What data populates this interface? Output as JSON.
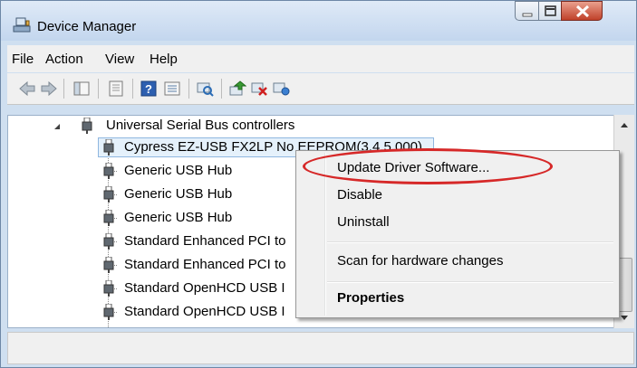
{
  "window": {
    "title": "Device Manager"
  },
  "menu": [
    "File",
    "Action",
    "View",
    "Help"
  ],
  "toolbar": {
    "buttons": [
      "back-icon",
      "forward-icon",
      "show-hide-tree-icon",
      "properties-icon",
      "help-icon",
      "view-icon",
      "scan-hardware-icon",
      "update-driver-icon",
      "uninstall-icon",
      "enable-icon"
    ]
  },
  "tree": {
    "category": "Universal Serial Bus controllers",
    "items": [
      "Cypress EZ-USB FX2LP No EEPROM(3.4.5.000)",
      "Generic USB Hub",
      "Generic USB Hub",
      "Generic USB Hub",
      "Standard Enhanced PCI to",
      "Standard Enhanced PCI to",
      "Standard OpenHCD USB I",
      "Standard OpenHCD USB I"
    ]
  },
  "context_menu": {
    "update_driver": "Update Driver Software...",
    "disable": "Disable",
    "uninstall": "Uninstall",
    "scan": "Scan for hardware changes",
    "properties": "Properties"
  },
  "colors": {
    "annotation": "#d62828",
    "selection": "#e5f1fb"
  }
}
